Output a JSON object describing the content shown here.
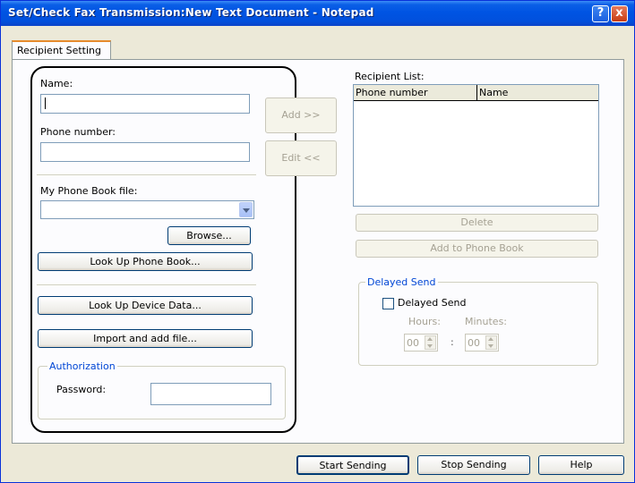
{
  "window": {
    "title": "Set/Check Fax Transmission:New Text Document - Notepad",
    "help_icon": "?",
    "close_icon": "x"
  },
  "tabs": [
    {
      "label": "Recipient Setting",
      "active": true
    }
  ],
  "left": {
    "name_label": "Name:",
    "name_value": "",
    "phone_label": "Phone number:",
    "phone_value": "",
    "phonebook_label": "My Phone Book file:",
    "phonebook_value": "",
    "browse_button": "Browse...",
    "lookup_phonebook_button": "Look Up Phone Book...",
    "lookup_device_button": "Look Up Device Data...",
    "import_button": "Import and add file...",
    "authorization": {
      "title": "Authorization",
      "password_label": "Password:",
      "password_value": ""
    }
  },
  "middle": {
    "add_button": "Add >>",
    "edit_button": "Edit <<"
  },
  "right": {
    "recipient_list_label": "Recipient List:",
    "columns": [
      "Phone number",
      "Name"
    ],
    "rows": [],
    "delete_button": "Delete",
    "add_to_phonebook_button": "Add to Phone Book",
    "delayed_send": {
      "title": "Delayed Send",
      "checkbox_label": "Delayed Send",
      "checked": false,
      "hours_label": "Hours:",
      "minutes_label": "Minutes:",
      "hours_value": "00",
      "minutes_value": "00",
      "separator": ":"
    }
  },
  "footer": {
    "start_button": "Start Sending",
    "stop_button": "Stop Sending",
    "help_button": "Help"
  },
  "colors": {
    "titlebar": "#0054e3",
    "dialog_bg": "#ece9d8",
    "group_title": "#0046d5",
    "tab_highlight": "#e68b2c"
  }
}
